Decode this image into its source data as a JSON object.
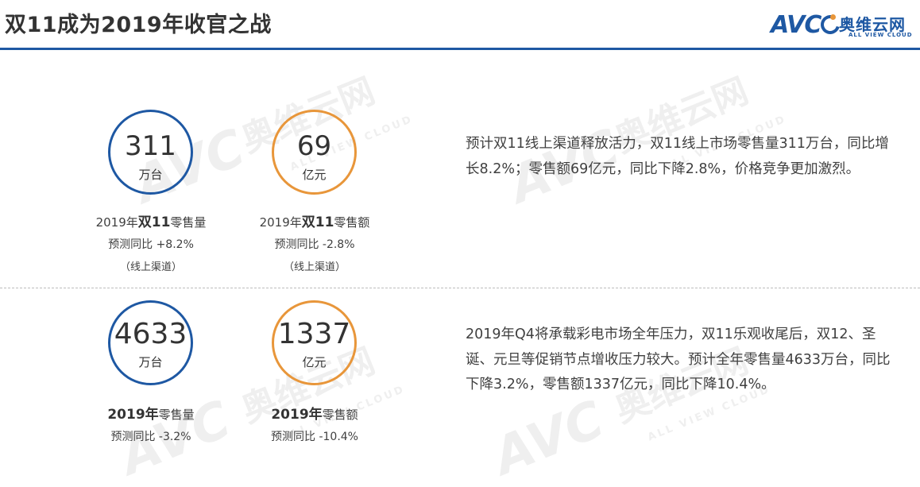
{
  "header": {
    "title": "双11成为2019年收官之战",
    "logo": {
      "brand": "AVC",
      "brand_cn": "奥维云网",
      "brand_en": "ALL VIEW CLOUD"
    },
    "accent_color": "#1e58a3"
  },
  "watermark": {
    "brand": "AVC",
    "brand_cn": "奥维云网",
    "brand_en": "ALL VIEW CLOUD"
  },
  "section1": {
    "stats": [
      {
        "value": "311",
        "unit": "万台",
        "caption_prefix": "2019年",
        "caption_bold": "双11",
        "caption_suffix": "零售量",
        "yoy": "预测同比 +8.2%",
        "note": "（线上渠道）",
        "ring_color": "#1e58a3"
      },
      {
        "value": "69",
        "unit": "亿元",
        "caption_prefix": "2019年",
        "caption_bold": "双11",
        "caption_suffix": "零售额",
        "yoy": "预测同比 -2.8%",
        "note": "（线上渠道）",
        "ring_color": "#e8963a"
      }
    ],
    "paragraph": "预计双11线上渠道释放活力，双11线上市场零售量311万台，同比增长8.2%；零售额69亿元，同比下降2.8%，价格竞争更加激烈。"
  },
  "section2": {
    "stats": [
      {
        "value": "4633",
        "unit": "万台",
        "caption_bold": "2019年",
        "caption_suffix": "零售量",
        "yoy": "预测同比 -3.2%",
        "ring_color": "#1e58a3"
      },
      {
        "value": "1337",
        "unit": "亿元",
        "caption_bold": "2019年",
        "caption_suffix": "零售额",
        "yoy": "预测同比 -10.4%",
        "ring_color": "#e8963a"
      }
    ],
    "paragraph": "2019年Q4将承载彩电市场全年压力，双11乐观收尾后，双12、圣诞、元旦等促销节点增收压力较大。预计全年零售量4633万台，同比下降3.2%，零售额1337亿元，同比下降10.4%。"
  }
}
